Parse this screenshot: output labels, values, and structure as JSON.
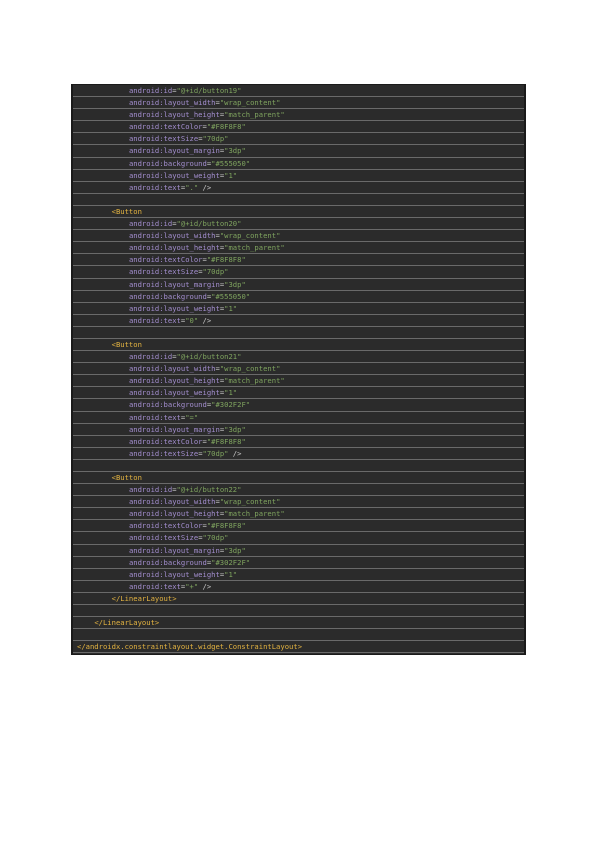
{
  "code_lines": [
    "            android:id=\"@+id/button19\"",
    "            android:layout_width=\"wrap_content\"",
    "            android:layout_height=\"match_parent\"",
    "            android:textColor=\"#F8F8F8\"",
    "            android:textSize=\"70dp\"",
    "            android:layout_margin=\"3dp\"",
    "            android:background=\"#555050\"",
    "            android:layout_weight=\"1\"",
    "            android:text=\".\" />",
    "",
    "        <Button",
    "            android:id=\"@+id/button20\"",
    "            android:layout_width=\"wrap_content\"",
    "            android:layout_height=\"match_parent\"",
    "            android:textColor=\"#F8F8F8\"",
    "            android:textSize=\"70dp\"",
    "            android:layout_margin=\"3dp\"",
    "            android:background=\"#555050\"",
    "            android:layout_weight=\"1\"",
    "            android:text=\"0\" />",
    "",
    "        <Button",
    "            android:id=\"@+id/button21\"",
    "            android:layout_width=\"wrap_content\"",
    "            android:layout_height=\"match_parent\"",
    "            android:layout_weight=\"1\"",
    "            android:background=\"#302F2F\"",
    "            android:text=\"=\"",
    "            android:layout_margin=\"3dp\"",
    "            android:textColor=\"#F8F8F8\"",
    "            android:textSize=\"70dp\" />",
    "",
    "        <Button",
    "            android:id=\"@+id/button22\"",
    "            android:layout_width=\"wrap_content\"",
    "            android:layout_height=\"match_parent\"",
    "            android:textColor=\"#F8F8F8\"",
    "            android:textSize=\"70dp\"",
    "            android:layout_margin=\"3dp\"",
    "            android:background=\"#302F2F\"",
    "            android:layout_weight=\"1\"",
    "            android:text=\"+\" />",
    "        </LinearLayout>",
    "",
    "    </LinearLayout>",
    "",
    "</androidx.constraintlayout.widget.ConstraintLayout>",
    "",
    ""
  ],
  "colors": {
    "background": "#2b2b2b",
    "attribute": "#a48fd0",
    "value": "#7fa45f",
    "tag": "#e3b341",
    "plain": "#c9c9c9"
  }
}
